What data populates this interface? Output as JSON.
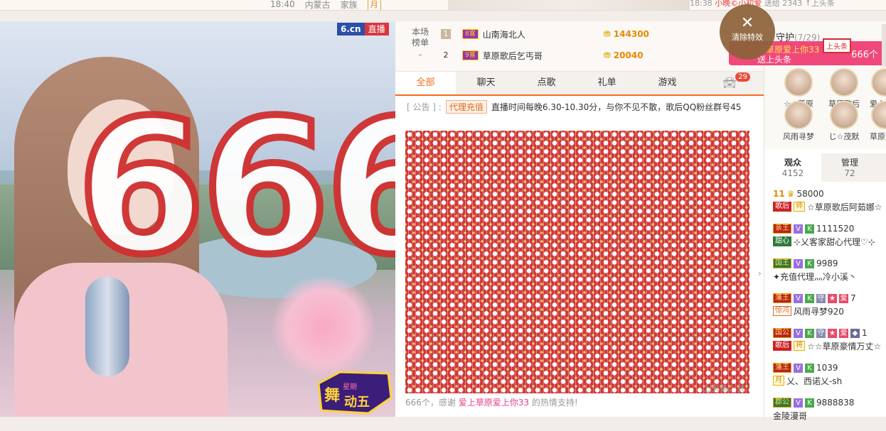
{
  "topbar": {
    "time": "18:40",
    "location": "内蒙古",
    "family_label": "家族",
    "family_tag": "月",
    "ticker_time": "18:38",
    "ticker_text_highlight": "小晚©小初爱",
    "ticker_text": "送给",
    "ticker_tail": "2343 ↑上头条"
  },
  "video": {
    "brand": "6.cn",
    "live_label": "直播",
    "overlay_number": "666",
    "logo_text": "舞动星期五"
  },
  "clear_effects": {
    "icon": "close-icon",
    "label": "清除特效"
  },
  "ranking": {
    "label_line1": "本场",
    "label_line2": "榜单",
    "rows": [
      {
        "rank": "1",
        "level": "8富",
        "name": "山南海北人",
        "value": "144300"
      },
      {
        "rank": "2",
        "level": "9富",
        "name": "草原歌后乞丐哥",
        "value": "20040"
      }
    ]
  },
  "tabs": [
    {
      "label": "全部",
      "active": true
    },
    {
      "label": "聊天",
      "active": false
    },
    {
      "label": "点歌",
      "active": false
    },
    {
      "label": "礼单",
      "active": false
    },
    {
      "label": "游戏",
      "active": false
    }
  ],
  "car_badge": "29",
  "notice": {
    "prefix": "[ 公告 ] :",
    "tag": "代理充值",
    "text": "直播时间每晚6.30-10.30分，与你不见不散，歌后QQ粉丝群号45"
  },
  "gift": {
    "count_text": "上头条，共",
    "thanks_prefix": "666个，感谢",
    "thanks_name": "爱上草原爱上你33",
    "thanks_suffix": "的热情支持!"
  },
  "guard": {
    "title": "守护",
    "count": "(7/29)",
    "banner_line1": "上草原爱上你33",
    "banner_line2": "送上头条",
    "banner_count": "666个",
    "banner_sign": "上头条",
    "members": [
      {
        "name": "☆☆草原"
      },
      {
        "name": "草原歌后"
      },
      {
        "name": "爱上"
      },
      {
        "name": "风雨寻梦"
      },
      {
        "name": "じ☆茂默"
      },
      {
        "name": "草原"
      }
    ]
  },
  "audience": {
    "tabs": [
      {
        "label": "观众",
        "count": "4152",
        "active": true
      },
      {
        "label": "管理",
        "count": "72",
        "active": false
      }
    ],
    "users": [
      {
        "level": "11",
        "points": "58000",
        "tag": "歌后",
        "tag2": "师",
        "name": "☆草原歌后阿茹娜☆"
      },
      {
        "rank": "亲王",
        "points": "1111520",
        "tag": "甜心",
        "name": "⊹乂客家甜心代理♡⊹"
      },
      {
        "rank": "国王",
        "points": "9989",
        "name": "✦充值代理灬冷小溪丶"
      },
      {
        "rank": "藩王",
        "points": "7",
        "tag": "惊鸿",
        "name": "风雨寻梦920"
      },
      {
        "rank": "国公",
        "points": "1",
        "tag": "歌后",
        "tag2": "将",
        "name": "☆☆草原豪情万丈☆"
      },
      {
        "rank": "藩王",
        "points": "1039",
        "tag": "月",
        "name": "乂、西诺乂-sh"
      },
      {
        "rank": "郡公",
        "points": "9888838",
        "name": "金陵漫哥"
      }
    ]
  },
  "colors": {
    "accent": "#f36b1c",
    "highlight": "#e8408a",
    "gold": "#e88a00"
  }
}
